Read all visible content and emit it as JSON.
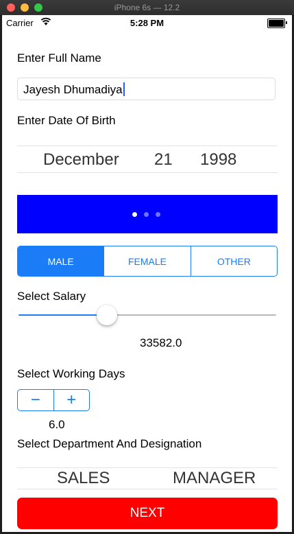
{
  "window": {
    "title": "iPhone 6s — 12.2"
  },
  "status_bar": {
    "carrier": "Carrier",
    "time": "5:28 PM"
  },
  "form": {
    "name_label": "Enter Full Name",
    "name_value": "Jayesh Dhumadiya",
    "dob_label": "Enter Date Of Birth",
    "dob": {
      "month": "December",
      "day": "21",
      "year": "1998"
    },
    "page_control": {
      "pages": 3,
      "current": 0
    },
    "gender": {
      "options": [
        "MALE",
        "FEMALE",
        "OTHER"
      ],
      "selected": "MALE"
    },
    "salary_label": "Select Salary",
    "salary_value": "33582.0",
    "working_days_label": "Select Working Days",
    "stepper": {
      "minus": "−",
      "plus": "+"
    },
    "working_days_value": "6.0",
    "department_label": "Select Department And Designation",
    "department": "SALES",
    "designation": "MANAGER",
    "next_label": "NEXT"
  },
  "colors": {
    "accent": "#1a7cf7",
    "pager_background": "#0000ff",
    "next_button": "#ff0000"
  }
}
